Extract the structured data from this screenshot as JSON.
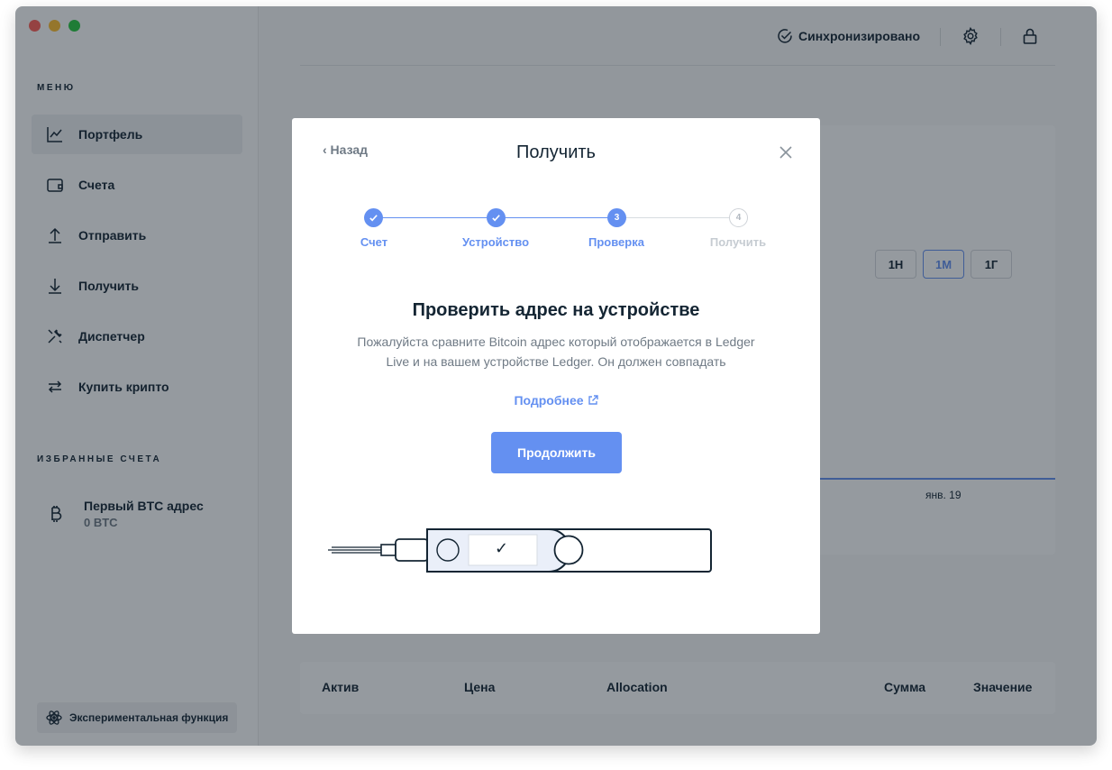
{
  "sidebar": {
    "menu_label": "МЕНЮ",
    "items": [
      {
        "label": "Портфель",
        "icon": "chart-icon",
        "active": true
      },
      {
        "label": "Счета",
        "icon": "wallet-icon"
      },
      {
        "label": "Отправить",
        "icon": "send-icon"
      },
      {
        "label": "Получить",
        "icon": "receive-icon"
      },
      {
        "label": "Диспетчер",
        "icon": "tools-icon"
      },
      {
        "label": "Купить крипто",
        "icon": "exchange-icon"
      }
    ],
    "favorites_label": "ИЗБРАННЫЕ СЧЕТА",
    "favorite": {
      "name": "Первый BTC адрес",
      "balance": "0 BTC",
      "icon": "bitcoin-icon"
    },
    "experimental_label": "Экспериментальная функция"
  },
  "topbar": {
    "sync_label": "Синхронизировано",
    "settings_icon": "gear-icon",
    "lock_icon": "lock-icon"
  },
  "chart": {
    "ranges": [
      "1Н",
      "1М",
      "1Г"
    ],
    "selected_range": "1М",
    "x_tick": "янв. 19"
  },
  "table": {
    "headers": [
      "Актив",
      "Цена",
      "Allocation",
      "Сумма",
      "Значение"
    ]
  },
  "modal": {
    "back_label": "‹ Назад",
    "title": "Получить",
    "steps": [
      {
        "label": "Счет",
        "state": "done"
      },
      {
        "label": "Устройство",
        "state": "done"
      },
      {
        "label": "Проверка",
        "state": "current",
        "number": "3"
      },
      {
        "label": "Получить",
        "state": "todo",
        "number": "4"
      }
    ],
    "heading": "Проверить адрес на устройстве",
    "description": "Пожалуйста сравните Bitcoin адрес который отображается в Ledger Live и на вашем устройстве Ledger. Он должен совпадать",
    "learn_more": "Подробнее",
    "continue_label": "Продолжить",
    "device_check": "✓"
  },
  "colors": {
    "accent": "#6490f1",
    "text": "#142533",
    "muted": "#6f7a85"
  }
}
